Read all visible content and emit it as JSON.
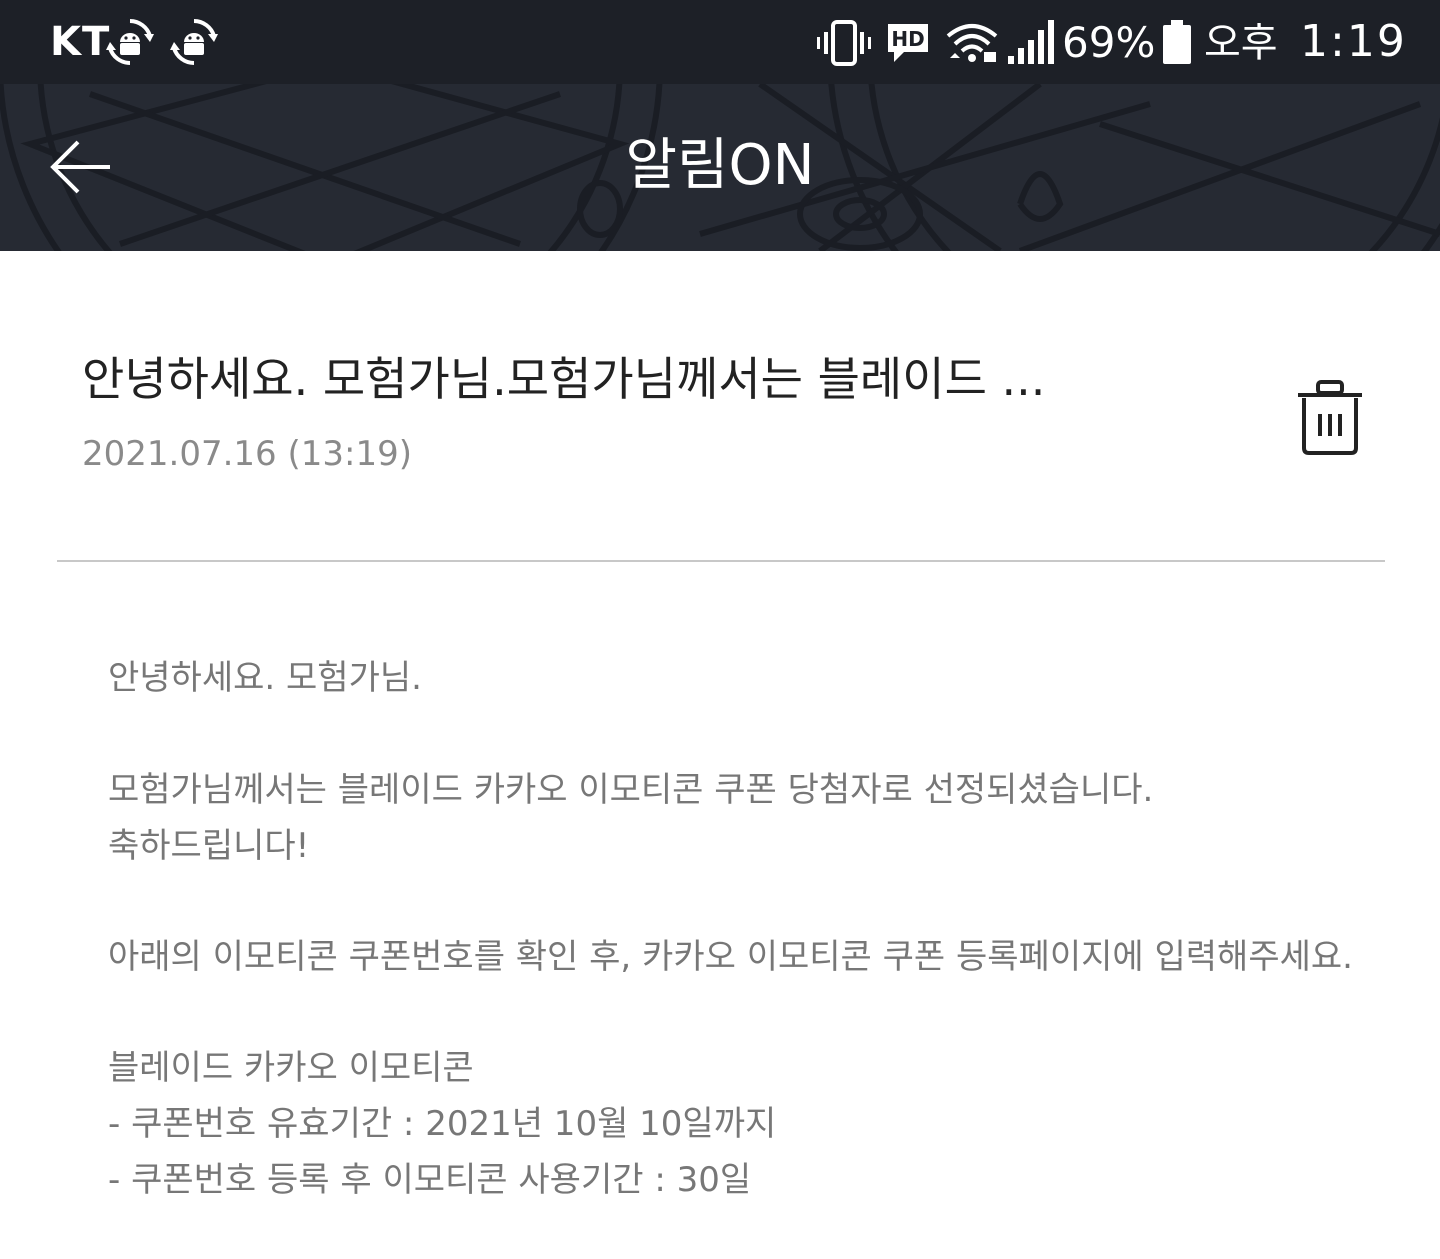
{
  "status_bar": {
    "carrier": "KT",
    "battery_percent": "69%",
    "ampm": "오후",
    "time": "1:19",
    "icons": [
      "android-sync-icon",
      "android-sync-icon",
      "vibrate-icon",
      "hd-voice-icon",
      "wifi-icon",
      "signal-icon",
      "battery-icon"
    ]
  },
  "header": {
    "title": "알림ON",
    "back_icon": "arrow-left-icon"
  },
  "message": {
    "title": "안녕하세요. 모험가님.모험가님께서는 블레이드 ...",
    "date": "2021.07.16 (13:19)",
    "delete_icon": "trash-icon",
    "body": [
      "안녕하세요. 모험가님.",
      "모험가님께서는 블레이드 카카오 이모티콘 쿠폰 당첨자로 선정되셨습니다.",
      "축하드립니다!",
      "아래의 이모티콘 쿠폰번호를 확인 후, 카카오 이모티콘 쿠폰 등록페이지에 입력해주세요.",
      "블레이드 카카오 이모티콘",
      "- 쿠폰번호 유효기간 : 2021년 10월 10일까지",
      "- 쿠폰번호 등록 후 이모티콘 사용기간 : 30일"
    ]
  },
  "colors": {
    "status_bar_bg": "#1d2027",
    "header_bg": "#262a33",
    "title_text": "#222222",
    "date_text": "#8a8a8a",
    "body_text": "#777777"
  }
}
